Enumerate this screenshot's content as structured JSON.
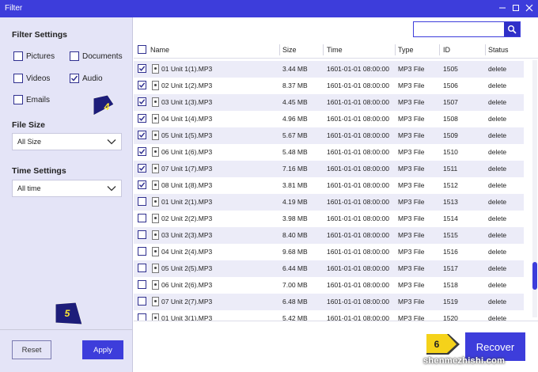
{
  "window": {
    "title": "Filter"
  },
  "sidebar": {
    "filter_settings_title": "Filter Settings",
    "types": [
      {
        "label": "Pictures",
        "checked": false
      },
      {
        "label": "Documents",
        "checked": false
      },
      {
        "label": "Videos",
        "checked": false
      },
      {
        "label": "Audio",
        "checked": true
      },
      {
        "label": "Emails",
        "checked": false
      }
    ],
    "file_size_title": "File Size",
    "file_size_value": "All Size",
    "time_settings_title": "Time Settings",
    "time_value": "All time",
    "reset_label": "Reset",
    "apply_label": "Apply"
  },
  "search": {
    "placeholder": "",
    "value": ""
  },
  "table": {
    "headers": {
      "name": "Name",
      "size": "Size",
      "time": "Time",
      "type": "Type",
      "id": "ID",
      "status": "Status"
    },
    "rows": [
      {
        "checked": true,
        "name": "01 Unit 1(1).MP3",
        "size": "3.44 MB",
        "time": "1601-01-01 08:00:00",
        "type": "MP3 File",
        "id": "1505",
        "status": "delete"
      },
      {
        "checked": true,
        "name": "02 Unit 1(2).MP3",
        "size": "8.37 MB",
        "time": "1601-01-01 08:00:00",
        "type": "MP3 File",
        "id": "1506",
        "status": "delete"
      },
      {
        "checked": true,
        "name": "03 Unit 1(3).MP3",
        "size": "4.45 MB",
        "time": "1601-01-01 08:00:00",
        "type": "MP3 File",
        "id": "1507",
        "status": "delete"
      },
      {
        "checked": true,
        "name": "04 Unit 1(4).MP3",
        "size": "4.96 MB",
        "time": "1601-01-01 08:00:00",
        "type": "MP3 File",
        "id": "1508",
        "status": "delete"
      },
      {
        "checked": true,
        "name": "05 Unit 1(5).MP3",
        "size": "5.67 MB",
        "time": "1601-01-01 08:00:00",
        "type": "MP3 File",
        "id": "1509",
        "status": "delete"
      },
      {
        "checked": true,
        "name": "06 Unit 1(6).MP3",
        "size": "5.48 MB",
        "time": "1601-01-01 08:00:00",
        "type": "MP3 File",
        "id": "1510",
        "status": "delete"
      },
      {
        "checked": true,
        "name": "07 Unit 1(7).MP3",
        "size": "7.16 MB",
        "time": "1601-01-01 08:00:00",
        "type": "MP3 File",
        "id": "1511",
        "status": "delete"
      },
      {
        "checked": true,
        "name": "08 Unit 1(8).MP3",
        "size": "3.81 MB",
        "time": "1601-01-01 08:00:00",
        "type": "MP3 File",
        "id": "1512",
        "status": "delete"
      },
      {
        "checked": false,
        "name": "01 Unit 2(1).MP3",
        "size": "4.19 MB",
        "time": "1601-01-01 08:00:00",
        "type": "MP3 File",
        "id": "1513",
        "status": "delete"
      },
      {
        "checked": false,
        "name": "02 Unit 2(2).MP3",
        "size": "3.98 MB",
        "time": "1601-01-01 08:00:00",
        "type": "MP3 File",
        "id": "1514",
        "status": "delete"
      },
      {
        "checked": false,
        "name": "03 Unit 2(3).MP3",
        "size": "8.40 MB",
        "time": "1601-01-01 08:00:00",
        "type": "MP3 File",
        "id": "1515",
        "status": "delete"
      },
      {
        "checked": false,
        "name": "04 Unit 2(4).MP3",
        "size": "9.68 MB",
        "time": "1601-01-01 08:00:00",
        "type": "MP3 File",
        "id": "1516",
        "status": "delete"
      },
      {
        "checked": false,
        "name": "05 Unit 2(5).MP3",
        "size": "6.44 MB",
        "time": "1601-01-01 08:00:00",
        "type": "MP3 File",
        "id": "1517",
        "status": "delete"
      },
      {
        "checked": false,
        "name": "06 Unit 2(6).MP3",
        "size": "7.00 MB",
        "time": "1601-01-01 08:00:00",
        "type": "MP3 File",
        "id": "1518",
        "status": "delete"
      },
      {
        "checked": false,
        "name": "07 Unit 2(7).MP3",
        "size": "6.48 MB",
        "time": "1601-01-01 08:00:00",
        "type": "MP3 File",
        "id": "1519",
        "status": "delete"
      },
      {
        "checked": false,
        "name": "01 Unit 3(1).MP3",
        "size": "5.42 MB",
        "time": "1601-01-01 08:00:00",
        "type": "MP3 File",
        "id": "1520",
        "status": "delete"
      }
    ]
  },
  "recover_label": "Recover",
  "annotations": {
    "step4": "4",
    "step5": "5",
    "step6": "6"
  },
  "watermark": "shenmezhishi.com",
  "colors": {
    "accent": "#3d3ddb",
    "sidebar_bg": "#e4e4f7",
    "row_alt": "#ececf8"
  },
  "icons": {
    "minimize": "minimize-icon",
    "maximize": "maximize-icon",
    "close": "close-icon",
    "search": "search-icon",
    "file": "mp3-file-icon",
    "caret": "chevron-down-icon"
  }
}
